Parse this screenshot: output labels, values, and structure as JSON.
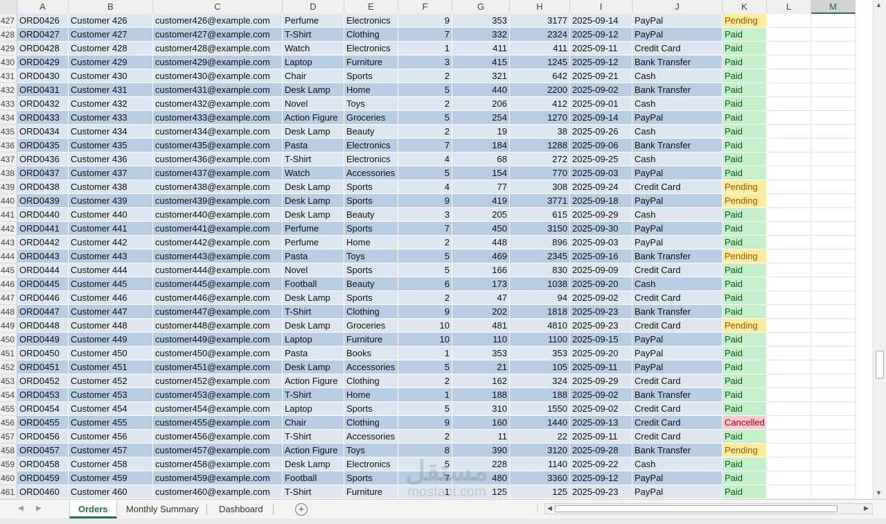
{
  "columns": [
    {
      "letter": "A",
      "w": 74
    },
    {
      "letter": "B",
      "w": 122
    },
    {
      "letter": "C",
      "w": 187
    },
    {
      "letter": "D",
      "w": 89
    },
    {
      "letter": "E",
      "w": 78
    },
    {
      "letter": "F",
      "w": 78
    },
    {
      "letter": "G",
      "w": 83
    },
    {
      "letter": "H",
      "w": 87
    },
    {
      "letter": "I",
      "w": 90
    },
    {
      "letter": "J",
      "w": 130
    },
    {
      "letter": "K",
      "w": 64
    },
    {
      "letter": "L",
      "w": 64
    },
    {
      "letter": "M",
      "w": 64
    }
  ],
  "active_column": "M",
  "rows": [
    {
      "n": "427",
      "id": "ORD0426",
      "customer": "Customer 426",
      "email": "customer426@example.com",
      "product": "Perfume",
      "category": "Electronics",
      "qty": "9",
      "price": "353",
      "total": "3177",
      "date": "2025-09-14",
      "payment": "PayPal",
      "status": "Pending"
    },
    {
      "n": "428",
      "id": "ORD0427",
      "customer": "Customer 427",
      "email": "customer427@example.com",
      "product": "T-Shirt",
      "category": "Clothing",
      "qty": "7",
      "price": "332",
      "total": "2324",
      "date": "2025-09-12",
      "payment": "PayPal",
      "status": "Paid"
    },
    {
      "n": "429",
      "id": "ORD0428",
      "customer": "Customer 428",
      "email": "customer428@example.com",
      "product": "Watch",
      "category": "Electronics",
      "qty": "1",
      "price": "411",
      "total": "411",
      "date": "2025-09-11",
      "payment": "Credit Card",
      "status": "Paid"
    },
    {
      "n": "430",
      "id": "ORD0429",
      "customer": "Customer 429",
      "email": "customer429@example.com",
      "product": "Laptop",
      "category": "Furniture",
      "qty": "3",
      "price": "415",
      "total": "1245",
      "date": "2025-09-12",
      "payment": "Bank Transfer",
      "status": "Paid"
    },
    {
      "n": "431",
      "id": "ORD0430",
      "customer": "Customer 430",
      "email": "customer430@example.com",
      "product": "Chair",
      "category": "Sports",
      "qty": "2",
      "price": "321",
      "total": "642",
      "date": "2025-09-21",
      "payment": "Cash",
      "status": "Paid"
    },
    {
      "n": "432",
      "id": "ORD0431",
      "customer": "Customer 431",
      "email": "customer431@example.com",
      "product": "Desk Lamp",
      "category": "Home",
      "qty": "5",
      "price": "440",
      "total": "2200",
      "date": "2025-09-02",
      "payment": "Bank Transfer",
      "status": "Paid"
    },
    {
      "n": "433",
      "id": "ORD0432",
      "customer": "Customer 432",
      "email": "customer432@example.com",
      "product": "Novel",
      "category": "Toys",
      "qty": "2",
      "price": "206",
      "total": "412",
      "date": "2025-09-01",
      "payment": "Cash",
      "status": "Paid"
    },
    {
      "n": "434",
      "id": "ORD0433",
      "customer": "Customer 433",
      "email": "customer433@example.com",
      "product": "Action Figure",
      "category": "Groceries",
      "qty": "5",
      "price": "254",
      "total": "1270",
      "date": "2025-09-14",
      "payment": "PayPal",
      "status": "Paid"
    },
    {
      "n": "435",
      "id": "ORD0434",
      "customer": "Customer 434",
      "email": "customer434@example.com",
      "product": "Desk Lamp",
      "category": "Beauty",
      "qty": "2",
      "price": "19",
      "total": "38",
      "date": "2025-09-26",
      "payment": "Cash",
      "status": "Paid"
    },
    {
      "n": "436",
      "id": "ORD0435",
      "customer": "Customer 435",
      "email": "customer435@example.com",
      "product": "Pasta",
      "category": "Electronics",
      "qty": "7",
      "price": "184",
      "total": "1288",
      "date": "2025-09-06",
      "payment": "Bank Transfer",
      "status": "Paid"
    },
    {
      "n": "437",
      "id": "ORD0436",
      "customer": "Customer 436",
      "email": "customer436@example.com",
      "product": "T-Shirt",
      "category": "Electronics",
      "qty": "4",
      "price": "68",
      "total": "272",
      "date": "2025-09-25",
      "payment": "Cash",
      "status": "Paid"
    },
    {
      "n": "438",
      "id": "ORD0437",
      "customer": "Customer 437",
      "email": "customer437@example.com",
      "product": "Watch",
      "category": "Accessories",
      "qty": "5",
      "price": "154",
      "total": "770",
      "date": "2025-09-03",
      "payment": "PayPal",
      "status": "Paid"
    },
    {
      "n": "439",
      "id": "ORD0438",
      "customer": "Customer 438",
      "email": "customer438@example.com",
      "product": "Desk Lamp",
      "category": "Sports",
      "qty": "4",
      "price": "77",
      "total": "308",
      "date": "2025-09-24",
      "payment": "Credit Card",
      "status": "Pending"
    },
    {
      "n": "440",
      "id": "ORD0439",
      "customer": "Customer 439",
      "email": "customer439@example.com",
      "product": "Desk Lamp",
      "category": "Sports",
      "qty": "9",
      "price": "419",
      "total": "3771",
      "date": "2025-09-18",
      "payment": "PayPal",
      "status": "Pending"
    },
    {
      "n": "441",
      "id": "ORD0440",
      "customer": "Customer 440",
      "email": "customer440@example.com",
      "product": "Desk Lamp",
      "category": "Beauty",
      "qty": "3",
      "price": "205",
      "total": "615",
      "date": "2025-09-29",
      "payment": "Cash",
      "status": "Paid"
    },
    {
      "n": "442",
      "id": "ORD0441",
      "customer": "Customer 441",
      "email": "customer441@example.com",
      "product": "Perfume",
      "category": "Sports",
      "qty": "7",
      "price": "450",
      "total": "3150",
      "date": "2025-09-30",
      "payment": "PayPal",
      "status": "Paid"
    },
    {
      "n": "443",
      "id": "ORD0442",
      "customer": "Customer 442",
      "email": "customer442@example.com",
      "product": "Perfume",
      "category": "Home",
      "qty": "2",
      "price": "448",
      "total": "896",
      "date": "2025-09-03",
      "payment": "PayPal",
      "status": "Paid"
    },
    {
      "n": "444",
      "id": "ORD0443",
      "customer": "Customer 443",
      "email": "customer443@example.com",
      "product": "Pasta",
      "category": "Toys",
      "qty": "5",
      "price": "469",
      "total": "2345",
      "date": "2025-09-16",
      "payment": "Bank Transfer",
      "status": "Pending"
    },
    {
      "n": "445",
      "id": "ORD0444",
      "customer": "Customer 444",
      "email": "customer444@example.com",
      "product": "Novel",
      "category": "Sports",
      "qty": "5",
      "price": "166",
      "total": "830",
      "date": "2025-09-09",
      "payment": "Credit Card",
      "status": "Paid"
    },
    {
      "n": "446",
      "id": "ORD0445",
      "customer": "Customer 445",
      "email": "customer445@example.com",
      "product": "Football",
      "category": "Beauty",
      "qty": "6",
      "price": "173",
      "total": "1038",
      "date": "2025-09-20",
      "payment": "Cash",
      "status": "Paid"
    },
    {
      "n": "447",
      "id": "ORD0446",
      "customer": "Customer 446",
      "email": "customer446@example.com",
      "product": "Desk Lamp",
      "category": "Sports",
      "qty": "2",
      "price": "47",
      "total": "94",
      "date": "2025-09-02",
      "payment": "Credit Card",
      "status": "Paid"
    },
    {
      "n": "448",
      "id": "ORD0447",
      "customer": "Customer 447",
      "email": "customer447@example.com",
      "product": "T-Shirt",
      "category": "Clothing",
      "qty": "9",
      "price": "202",
      "total": "1818",
      "date": "2025-09-23",
      "payment": "Bank Transfer",
      "status": "Paid"
    },
    {
      "n": "449",
      "id": "ORD0448",
      "customer": "Customer 448",
      "email": "customer448@example.com",
      "product": "Desk Lamp",
      "category": "Groceries",
      "qty": "10",
      "price": "481",
      "total": "4810",
      "date": "2025-09-23",
      "payment": "Credit Card",
      "status": "Pending"
    },
    {
      "n": "450",
      "id": "ORD0449",
      "customer": "Customer 449",
      "email": "customer449@example.com",
      "product": "Laptop",
      "category": "Furniture",
      "qty": "10",
      "price": "110",
      "total": "1100",
      "date": "2025-09-15",
      "payment": "PayPal",
      "status": "Paid"
    },
    {
      "n": "451",
      "id": "ORD0450",
      "customer": "Customer 450",
      "email": "customer450@example.com",
      "product": "Pasta",
      "category": "Books",
      "qty": "1",
      "price": "353",
      "total": "353",
      "date": "2025-09-20",
      "payment": "PayPal",
      "status": "Paid"
    },
    {
      "n": "452",
      "id": "ORD0451",
      "customer": "Customer 451",
      "email": "customer451@example.com",
      "product": "Desk Lamp",
      "category": "Accessories",
      "qty": "5",
      "price": "21",
      "total": "105",
      "date": "2025-09-11",
      "payment": "PayPal",
      "status": "Paid"
    },
    {
      "n": "453",
      "id": "ORD0452",
      "customer": "Customer 452",
      "email": "customer452@example.com",
      "product": "Action Figure",
      "category": "Clothing",
      "qty": "2",
      "price": "162",
      "total": "324",
      "date": "2025-09-29",
      "payment": "Credit Card",
      "status": "Paid"
    },
    {
      "n": "454",
      "id": "ORD0453",
      "customer": "Customer 453",
      "email": "customer453@example.com",
      "product": "T-Shirt",
      "category": "Home",
      "qty": "1",
      "price": "188",
      "total": "188",
      "date": "2025-09-02",
      "payment": "Bank Transfer",
      "status": "Paid"
    },
    {
      "n": "455",
      "id": "ORD0454",
      "customer": "Customer 454",
      "email": "customer454@example.com",
      "product": "Laptop",
      "category": "Sports",
      "qty": "5",
      "price": "310",
      "total": "1550",
      "date": "2025-09-02",
      "payment": "Credit Card",
      "status": "Paid"
    },
    {
      "n": "456",
      "id": "ORD0455",
      "customer": "Customer 455",
      "email": "customer455@example.com",
      "product": "Chair",
      "category": "Clothing",
      "qty": "9",
      "price": "160",
      "total": "1440",
      "date": "2025-09-13",
      "payment": "Credit Card",
      "status": "Cancelled"
    },
    {
      "n": "457",
      "id": "ORD0456",
      "customer": "Customer 456",
      "email": "customer456@example.com",
      "product": "T-Shirt",
      "category": "Accessories",
      "qty": "2",
      "price": "11",
      "total": "22",
      "date": "2025-09-11",
      "payment": "Credit Card",
      "status": "Paid"
    },
    {
      "n": "458",
      "id": "ORD0457",
      "customer": "Customer 457",
      "email": "customer457@example.com",
      "product": "Action Figure",
      "category": "Toys",
      "qty": "8",
      "price": "390",
      "total": "3120",
      "date": "2025-09-28",
      "payment": "Bank Transfer",
      "status": "Pending"
    },
    {
      "n": "459",
      "id": "ORD0458",
      "customer": "Customer 458",
      "email": "customer458@example.com",
      "product": "Desk Lamp",
      "category": "Electronics",
      "qty": "5",
      "price": "228",
      "total": "1140",
      "date": "2025-09-22",
      "payment": "Cash",
      "status": "Paid"
    },
    {
      "n": "460",
      "id": "ORD0459",
      "customer": "Customer 459",
      "email": "customer459@example.com",
      "product": "Football",
      "category": "Sports",
      "qty": "7",
      "price": "480",
      "total": "3360",
      "date": "2025-09-12",
      "payment": "PayPal",
      "status": "Paid"
    },
    {
      "n": "461",
      "id": "ORD0460",
      "customer": "Customer 460",
      "email": "customer460@example.com",
      "product": "T-Shirt",
      "category": "Furniture",
      "qty": "1",
      "price": "125",
      "total": "125",
      "date": "2025-09-23",
      "payment": "PayPal",
      "status": "Paid"
    }
  ],
  "sheet_tabs": {
    "orders": "Orders",
    "monthly_summary": "Monthly Summary",
    "dashboard": "Dashboard",
    "add_symbol": "+",
    "overflow": "⋮"
  },
  "status_colors": {
    "Paid": "#c6efce",
    "Pending": "#ffeb9c",
    "Cancelled": "#ffc7ce"
  },
  "band_colors": {
    "light": "#dce6f1",
    "dark": "#b8cce4"
  },
  "accent_color": "#217346",
  "watermark": {
    "arabic": "مستقل",
    "latin": "mostaqi.com"
  }
}
